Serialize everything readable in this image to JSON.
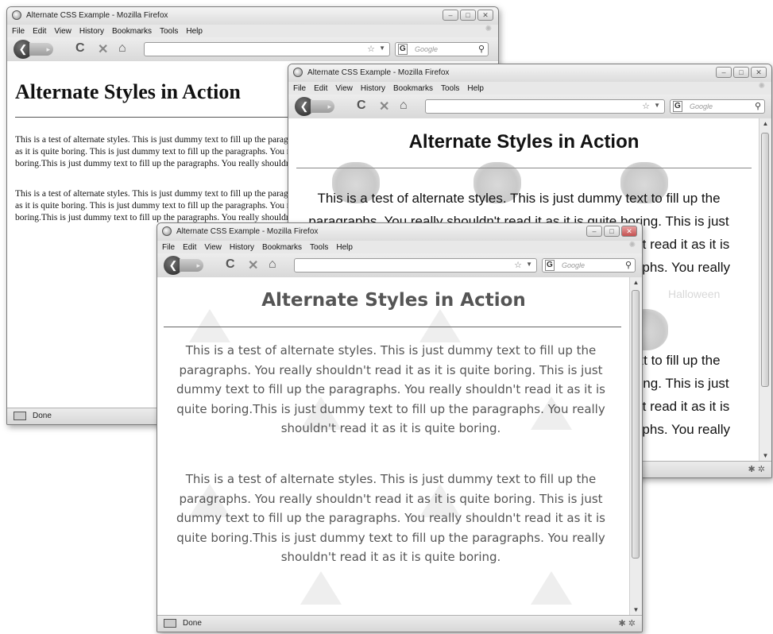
{
  "browser": {
    "title": "Alternate CSS Example - Mozilla Firefox",
    "menu": [
      "File",
      "Edit",
      "View",
      "History",
      "Bookmarks",
      "Tools",
      "Help"
    ],
    "search_placeholder": "Google",
    "status": "Done",
    "window_buttons": [
      "–",
      "□",
      "✕"
    ]
  },
  "page": {
    "heading": "Alternate Styles in Action",
    "paragraph": "This is a test of alternate styles. This is just dummy text to fill up the paragraphs. You really shouldn't read it as it is quite boring. This is just dummy text to fill up the paragraphs. You really shouldn't read it as it is quite boring.This is just dummy text to fill up the paragraphs. You really shouldn't read it as it is quite boring."
  },
  "window_a": {
    "p1_lines": [
      "This is a test of alternate styles. This is just dummy text to fill up the paragraphs. You really shouldn't read it",
      "as it is quite boring. This is just dummy text to fill up the paragraphs. You really shouldn't read it as it is quite",
      "boring.This is just dummy text to fill up the paragraphs. You really shouldn't read it as it is quite boring."
    ],
    "p2_lines": [
      "This is a test of alternate styles. This is just dummy text to fill up the paragraphs. You really shouldn't read it",
      "as it is quite boring. This is just dummy text to fill up the paragraphs. You really shouldn't read it as it is quite",
      "boring.This is just dummy text to fill up the paragraphs. You really shouldn't read it as it is quite boring."
    ]
  },
  "window_b": {
    "watermark": "Halloween"
  }
}
